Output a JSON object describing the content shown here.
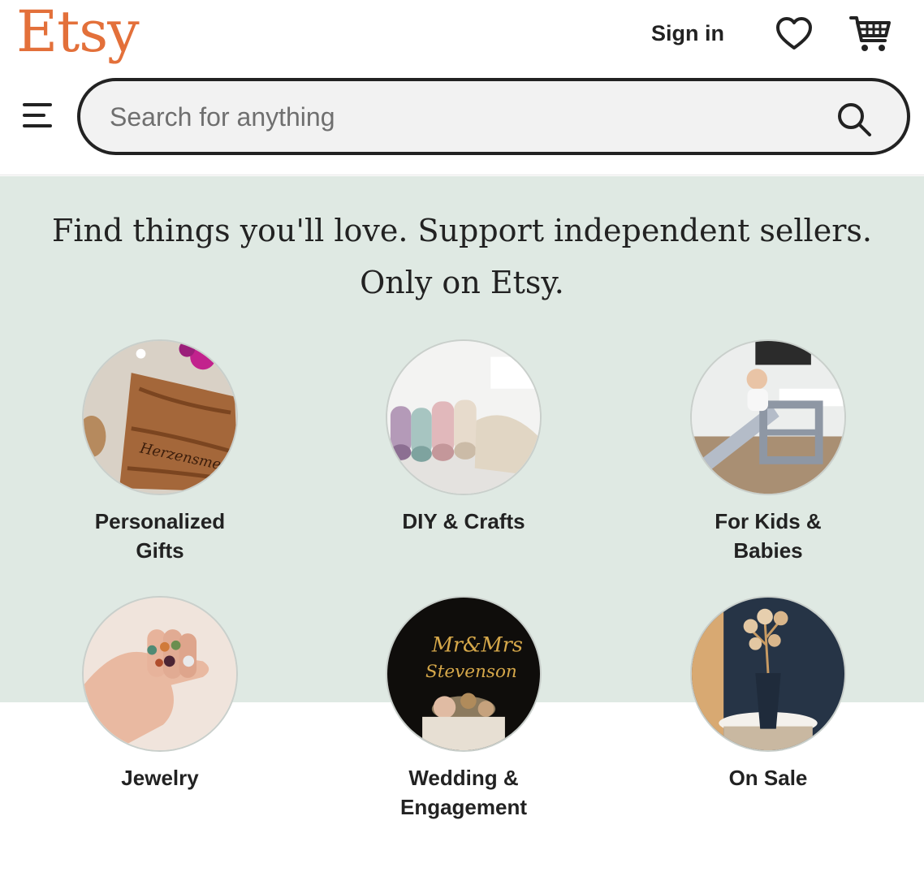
{
  "header": {
    "logo": "Etsy",
    "sign_in": "Sign in",
    "brand_color": "#e3703a",
    "icons": [
      "menu-icon",
      "search-icon",
      "heart-icon",
      "cart-icon"
    ]
  },
  "search": {
    "placeholder": "Search for anything",
    "value": ""
  },
  "hero": {
    "tagline": "Find things you'll love. Support independent sellers. Only on Etsy.",
    "background": "#dfe9e3"
  },
  "categories": [
    {
      "label": "Personalized Gifts"
    },
    {
      "label": "DIY & Crafts"
    },
    {
      "label": "For Kids & Babies"
    },
    {
      "label": "Jewelry"
    },
    {
      "label": "Wedding & Engagement"
    },
    {
      "label": "On Sale"
    }
  ]
}
